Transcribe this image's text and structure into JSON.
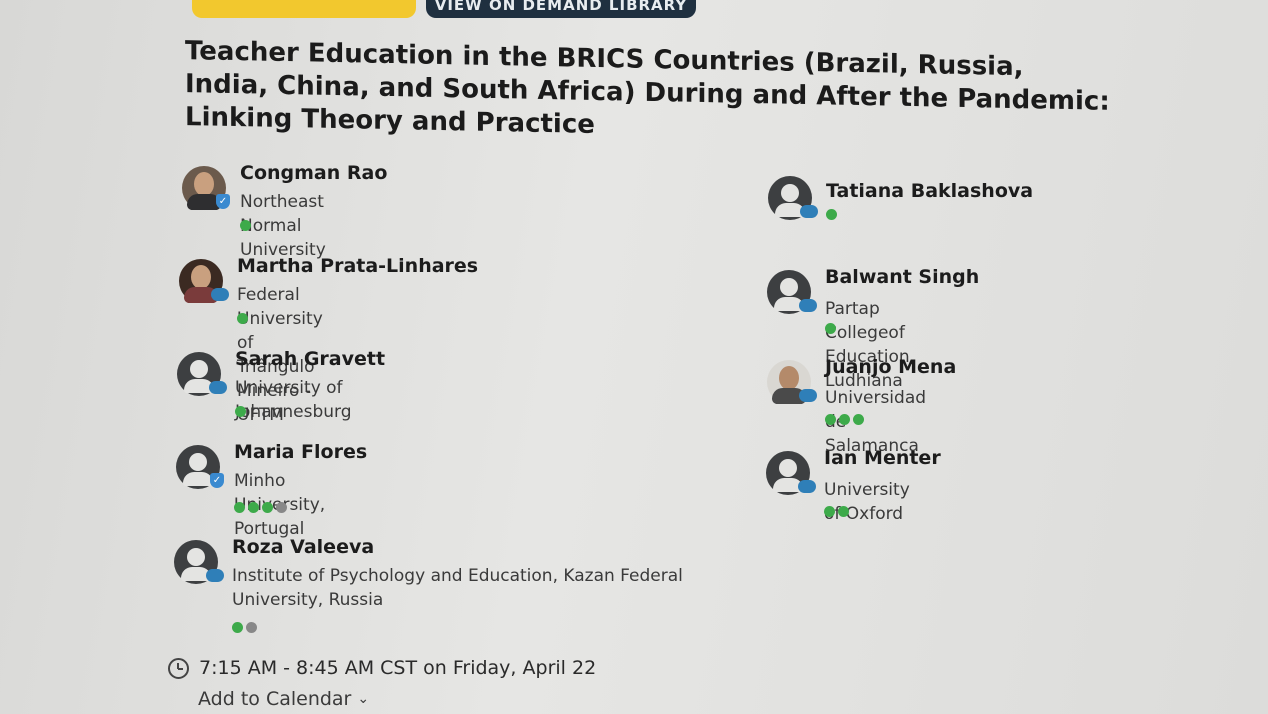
{
  "top_buttons": {
    "left_label": "",
    "right_label": "VIEW ON DEMAND LIBRARY"
  },
  "session": {
    "title": "Teacher Education in the BRICS Countries (Brazil, Russia, India, China, and South Africa) During and After the Pandemic: Linking Theory and Practice",
    "time": "7:15 AM - 8:45 AM CST on Friday, April 22",
    "add_to_calendar": "Add to Calendar"
  },
  "speakers_left": [
    {
      "name": "Congman Rao",
      "org": "Northeast Normal University",
      "avatar": "photo",
      "badge": "shield",
      "level": {
        "green": 1,
        "grey": 0
      }
    },
    {
      "name": "Martha Prata-Linhares",
      "org": "Federal University of Triângulo Mineiro - UFTM",
      "avatar": "photo",
      "badge": "cloud",
      "level": {
        "green": 1,
        "grey": 0
      }
    },
    {
      "name": "Sarah Gravett",
      "org": "University of Johannesburg",
      "avatar": "generic",
      "badge": "cloud",
      "level": {
        "green": 1,
        "grey": 0
      }
    },
    {
      "name": "Maria Flores",
      "org": "Minho University, Portugal",
      "avatar": "generic",
      "badge": "shield",
      "level": {
        "green": 3,
        "grey": 1
      }
    },
    {
      "name": "Roza Valeeva",
      "org": "Institute of Psychology and Education, Kazan Federal University, Russia",
      "avatar": "generic",
      "badge": "cloud",
      "level": {
        "green": 1,
        "grey": 1
      }
    }
  ],
  "speakers_right": [
    {
      "name": "Tatiana Baklashova",
      "org": "",
      "avatar": "generic",
      "badge": "cloud",
      "level": {
        "green": 1,
        "grey": 0
      }
    },
    {
      "name": "Balwant Singh",
      "org": "Partap Collegeof Education, Ludhiana",
      "avatar": "generic",
      "badge": "cloud",
      "level": {
        "green": 1,
        "grey": 0
      }
    },
    {
      "name": "Juanjo Mena",
      "org": "Universidad de Salamanca",
      "avatar": "photo",
      "badge": "cloud",
      "level": {
        "green": 3,
        "grey": 0
      }
    },
    {
      "name": "Ian Menter",
      "org": "University of Oxford",
      "avatar": "generic",
      "badge": "cloud",
      "level": {
        "green": 2,
        "grey": 0
      }
    }
  ],
  "colors": {
    "accent_yellow": "#f2c82e",
    "dark_button": "#1f3040",
    "level_green": "#3daa4a",
    "level_grey": "#888888",
    "badge_blue": "#2f7fb8"
  }
}
